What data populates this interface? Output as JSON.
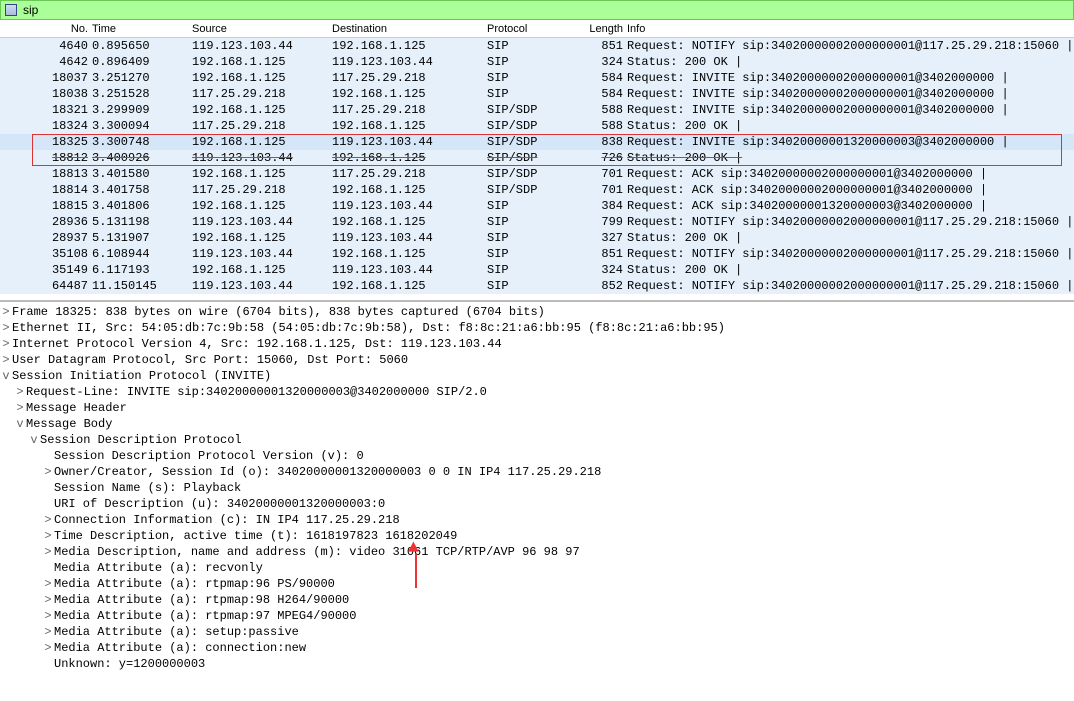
{
  "filter": {
    "value": "sip"
  },
  "columns": {
    "no": "No.",
    "time": "Time",
    "source": "Source",
    "destination": "Destination",
    "protocol": "Protocol",
    "length": "Length",
    "info": "Info"
  },
  "packets": [
    {
      "no": "4640",
      "time": "0.895650",
      "src": "119.123.103.44",
      "dst": "192.168.1.125",
      "proto": "SIP",
      "len": "851",
      "info": "Request: NOTIFY sip:34020000002000000001@117.25.29.218:15060 |"
    },
    {
      "no": "4642",
      "time": "0.896409",
      "src": "192.168.1.125",
      "dst": "119.123.103.44",
      "proto": "SIP",
      "len": "324",
      "info": "Status: 200 OK |"
    },
    {
      "no": "18037",
      "time": "3.251270",
      "src": "192.168.1.125",
      "dst": "117.25.29.218",
      "proto": "SIP",
      "len": "584",
      "info": "Request: INVITE sip:34020000002000000001@3402000000 |"
    },
    {
      "no": "18038",
      "time": "3.251528",
      "src": "117.25.29.218",
      "dst": "192.168.1.125",
      "proto": "SIP",
      "len": "584",
      "info": "Request: INVITE sip:34020000002000000001@3402000000 |"
    },
    {
      "no": "18321",
      "time": "3.299909",
      "src": "192.168.1.125",
      "dst": "117.25.29.218",
      "proto": "SIP/SDP",
      "len": "588",
      "info": "Request: INVITE sip:34020000002000000001@3402000000 |"
    },
    {
      "no": "18324",
      "time": "3.300094",
      "src": "117.25.29.218",
      "dst": "192.168.1.125",
      "proto": "SIP/SDP",
      "len": "588",
      "info": "Status: 200 OK |"
    },
    {
      "no": "18325",
      "time": "3.300748",
      "src": "192.168.1.125",
      "dst": "119.123.103.44",
      "proto": "SIP/SDP",
      "len": "838",
      "info": "Request: INVITE sip:34020000001320000003@3402000000 |",
      "hilite": true
    },
    {
      "no": "18812",
      "time": "3.400926",
      "src": "119.123.103.44",
      "dst": "192.168.1.125",
      "proto": "SIP/SDP",
      "len": "726",
      "info": "Status: 200 OK |",
      "hilite": true,
      "strike": true
    },
    {
      "no": "18813",
      "time": "3.401580",
      "src": "192.168.1.125",
      "dst": "117.25.29.218",
      "proto": "SIP/SDP",
      "len": "701",
      "info": "Request: ACK sip:34020000002000000001@3402000000 |"
    },
    {
      "no": "18814",
      "time": "3.401758",
      "src": "117.25.29.218",
      "dst": "192.168.1.125",
      "proto": "SIP/SDP",
      "len": "701",
      "info": "Request: ACK sip:34020000002000000001@3402000000 |"
    },
    {
      "no": "18815",
      "time": "3.401806",
      "src": "192.168.1.125",
      "dst": "119.123.103.44",
      "proto": "SIP",
      "len": "384",
      "info": "Request: ACK sip:34020000001320000003@3402000000 |"
    },
    {
      "no": "28936",
      "time": "5.131198",
      "src": "119.123.103.44",
      "dst": "192.168.1.125",
      "proto": "SIP",
      "len": "799",
      "info": "Request: NOTIFY sip:34020000002000000001@117.25.29.218:15060 |"
    },
    {
      "no": "28937",
      "time": "5.131907",
      "src": "192.168.1.125",
      "dst": "119.123.103.44",
      "proto": "SIP",
      "len": "327",
      "info": "Status: 200 OK |"
    },
    {
      "no": "35108",
      "time": "6.108944",
      "src": "119.123.103.44",
      "dst": "192.168.1.125",
      "proto": "SIP",
      "len": "851",
      "info": "Request: NOTIFY sip:34020000002000000001@117.25.29.218:15060 |"
    },
    {
      "no": "35149",
      "time": "6.117193",
      "src": "192.168.1.125",
      "dst": "119.123.103.44",
      "proto": "SIP",
      "len": "324",
      "info": "Status: 200 OK |"
    },
    {
      "no": "64487",
      "time": "11.150145",
      "src": "119.123.103.44",
      "dst": "192.168.1.125",
      "proto": "SIP",
      "len": "852",
      "info": "Request: NOTIFY sip:34020000002000000001@117.25.29.218:15060 |"
    }
  ],
  "tree": {
    "frame": "Frame 18325: 838 bytes on wire (6704 bits), 838 bytes captured (6704 bits)",
    "eth": "Ethernet II, Src: 54:05:db:7c:9b:58 (54:05:db:7c:9b:58), Dst: f8:8c:21:a6:bb:95 (f8:8c:21:a6:bb:95)",
    "ip": "Internet Protocol Version 4, Src: 192.168.1.125, Dst: 119.123.103.44",
    "udp": "User Datagram Protocol, Src Port: 15060, Dst Port: 5060",
    "sip": "Session Initiation Protocol (INVITE)",
    "reqline": "Request-Line: INVITE sip:34020000001320000003@3402000000 SIP/2.0",
    "msgheader": "Message Header",
    "msgbody": "Message Body",
    "sdp": "Session Description Protocol",
    "v": "Session Description Protocol Version (v): 0",
    "o": "Owner/Creator, Session Id (o): 34020000001320000003 0 0 IN IP4 117.25.29.218",
    "s": "Session Name (s): Playback",
    "u": "URI of Description (u): 34020000001320000003:0",
    "c": "Connection Information (c): IN IP4 117.25.29.218",
    "t": "Time Description, active time (t): 1618197823 1618202049",
    "m": "Media Description, name and address (m): video 31061 TCP/RTP/AVP 96 98 97",
    "a1": "Media Attribute (a): recvonly",
    "a2": "Media Attribute (a): rtpmap:96 PS/90000",
    "a3": "Media Attribute (a): rtpmap:98 H264/90000",
    "a4": "Media Attribute (a): rtpmap:97 MPEG4/90000",
    "a5": "Media Attribute (a): setup:passive",
    "a6": "Media Attribute (a): connection:new",
    "y": "Unknown: y=1200000003"
  }
}
